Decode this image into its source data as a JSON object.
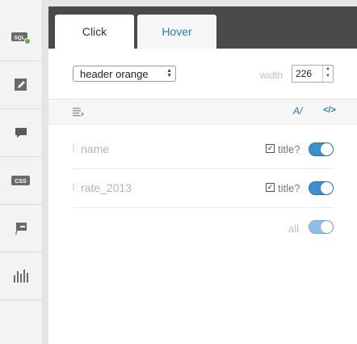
{
  "rail": {
    "items": [
      {
        "icon": "sql-icon",
        "text": "SQL"
      },
      {
        "icon": "edit-icon"
      },
      {
        "icon": "infowindow-icon"
      },
      {
        "icon": "css-icon",
        "text": "CSS"
      },
      {
        "icon": "legend-icon"
      },
      {
        "icon": "chart-icon"
      }
    ]
  },
  "tabs": [
    {
      "label": "Click"
    },
    {
      "label": "Hover"
    }
  ],
  "controls": {
    "template_value": "header orange",
    "width_label": "width",
    "width_value": "226"
  },
  "toolbar": {
    "az_label": "A/",
    "code_label": "</>"
  },
  "fields": [
    {
      "name": "name",
      "title_label": "title?",
      "title_checked": true,
      "enabled": true
    },
    {
      "name": "rate_2013",
      "title_label": "title?",
      "title_checked": true,
      "enabled": true
    }
  ],
  "all": {
    "label": "all",
    "enabled": true
  },
  "colors": {
    "accent": "#3a8fd0",
    "tabbar": "#4a4a4a",
    "link": "#2a7bb5",
    "status_dot": "#5bb43a"
  }
}
